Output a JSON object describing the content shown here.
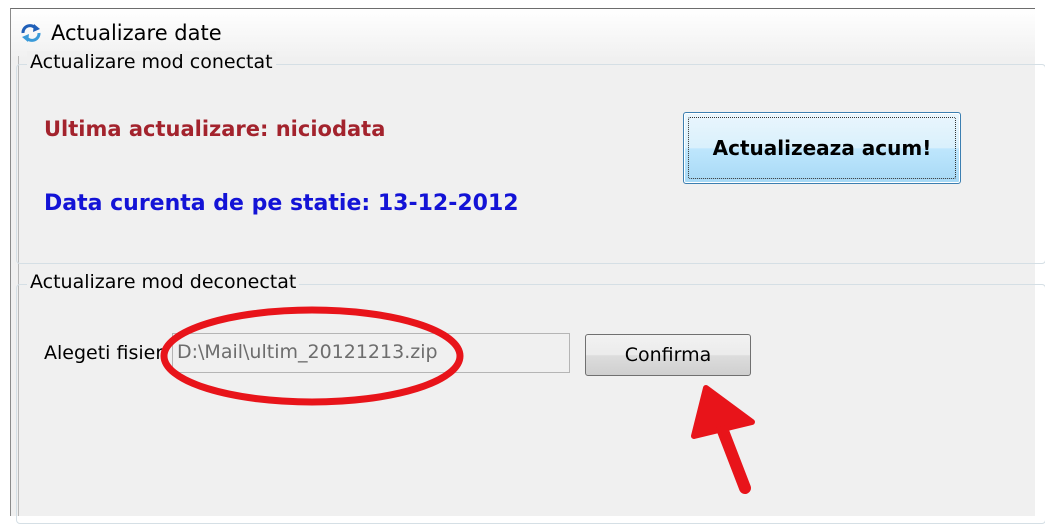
{
  "window": {
    "title": "Actualizare date",
    "icon": "refresh-icon"
  },
  "connected_group": {
    "legend": "Actualizare mod conectat",
    "last_update": "Ultima actualizare: niciodata",
    "current_date": "Data curenta de pe statie: 13-12-2012",
    "update_button_label": "Actualizeaza acum!"
  },
  "disconnected_group": {
    "legend": "Actualizare mod deconectat",
    "file_label": "Alegeti fisier",
    "file_value": "D:\\Mail\\ultim_20121213.zip",
    "confirm_button_label": "Confirma"
  },
  "annotations": {
    "highlight_color": "#e8141a",
    "arrow_color": "#e8141a"
  },
  "colors": {
    "last_update_text": "#a3232d",
    "current_date_text": "#1313d6"
  }
}
